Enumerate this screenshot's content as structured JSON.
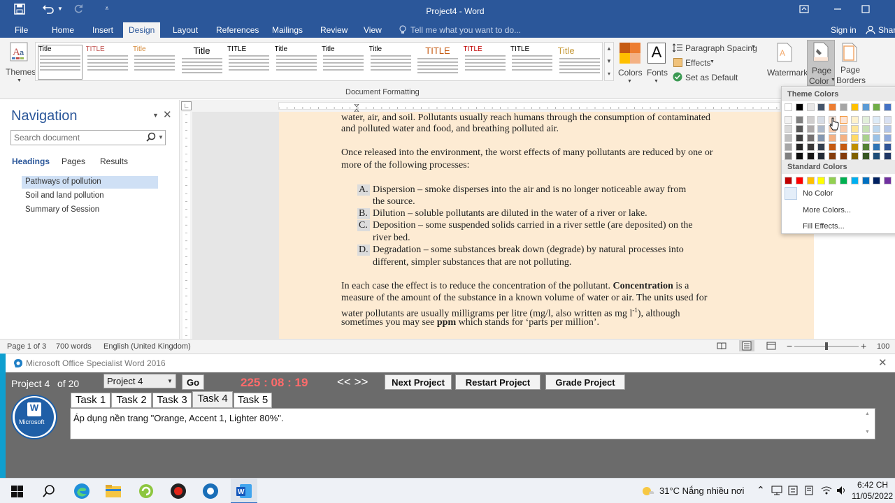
{
  "window": {
    "title": "Project4 - Word",
    "quick_access": [
      "save-icon",
      "undo-icon",
      "redo-icon",
      "customize-icon"
    ]
  },
  "tabs": {
    "file": "File",
    "home": "Home",
    "insert": "Insert",
    "design": "Design",
    "layout": "Layout",
    "references": "References",
    "mailings": "Mailings",
    "review": "Review",
    "view": "View",
    "tell_me": "Tell me what you want to do...",
    "sign_in": "Sign in",
    "share": "Shar"
  },
  "ribbon": {
    "themes": "Themes",
    "colors": "Colors",
    "fonts": "Fonts",
    "paragraph_spacing": "Paragraph Spacing",
    "effects": "Effects",
    "set_default": "Set as Default",
    "watermark": "Watermark",
    "page_color_1": "Page",
    "page_color_2": "Color",
    "page_borders_1": "Page",
    "page_borders_2": "Borders",
    "group_label": "Document Formatting",
    "style_titles": [
      "Title",
      "TITLE",
      "Title",
      "Title",
      "TITLE",
      "Title",
      "Title",
      "Title",
      "TITLE",
      "TITLE",
      "TITLE",
      "Title"
    ],
    "style_title_colors": [
      "#000000",
      "#c0504d",
      "#d58a3a",
      "#000000",
      "#000000",
      "#000000",
      "#000000",
      "#000000",
      "#c55a11",
      "#c00000",
      "#000000",
      "#c69a3a"
    ]
  },
  "nav": {
    "title": "Navigation",
    "search_placeholder": "Search document",
    "tab_headings": "Headings",
    "tab_pages": "Pages",
    "tab_results": "Results",
    "headings": [
      "Pathways of pollution",
      "Soil and land pollution",
      "Summary of Session"
    ]
  },
  "doc": {
    "p1_l1": "water, air, and soil. Pollutants usually reach humans through the consumption of contaminated",
    "p1_l2": "and polluted water and food, and breathing polluted air.",
    "p2_l1": "Once released into the environment, the worst effects of many pollutants are reduced by one or",
    "p2_l2": "more of the following processes:",
    "list": [
      {
        "letter": "A.",
        "l1": "Dispersion – smoke disperses into the air and is no longer noticeable away from",
        "l2": "the source."
      },
      {
        "letter": "B.",
        "l1": "Dilution – soluble pollutants are diluted in the water of a river or lake.",
        "l2": ""
      },
      {
        "letter": "C.",
        "l1": "Deposition – some suspended solids carried in a river settle (are deposited) on the",
        "l2": "river bed."
      },
      {
        "letter": "D.",
        "l1": "Degradation – some substances break down (degrade) by natural processes into",
        "l2": "different, simpler substances that are not polluting."
      }
    ],
    "p3_l1a": "In each case the effect is to reduce the concentration of the pollutant. ",
    "p3_l1b": "Concentration",
    "p3_l1c": " is a",
    "p3_l2": "measure of the amount of the substance in a known volume of water or air. The units used for",
    "p3_l3a": "water pollutants are usually milligrams per litre (mg/l, also written as mg l",
    "p3_l3sup": "-1",
    "p3_l3b": "), although",
    "p3_l4a": "sometimes you may see ",
    "p3_l4b": "ppm",
    "p3_l4c": " which stands for ‘parts per million’."
  },
  "status": {
    "page": "Page 1 of 3",
    "words": "700 words",
    "language": "English (United Kingdom)",
    "zoom": "100"
  },
  "color_panel": {
    "theme_title": "Theme Colors",
    "standard_title": "Standard Colors",
    "no_color": "No Color",
    "more_colors": "More Colors...",
    "fill_effects": "Fill Effects...",
    "theme_top": [
      "#ffffff",
      "#000000",
      "#e7e6e6",
      "#44546a",
      "#ed7d31",
      "#a5a5a5",
      "#ffc000",
      "#5b9bd5",
      "#70ad47",
      "#4472c4",
      "#ed7d31"
    ],
    "theme_columns": [
      [
        "#f2f2f2",
        "#d9d9d9",
        "#bfbfbf",
        "#a6a6a6",
        "#808080"
      ],
      [
        "#808080",
        "#595959",
        "#404040",
        "#262626",
        "#0d0d0d"
      ],
      [
        "#d0cece",
        "#aeaaaa",
        "#757171",
        "#3a3838",
        "#171616"
      ],
      [
        "#d6dce5",
        "#adb9ca",
        "#8497b0",
        "#333f50",
        "#222a35"
      ],
      [
        "#fbe5d6",
        "#f8cbad",
        "#f4b183",
        "#c55a11",
        "#843c0c"
      ],
      [
        "#fce4d6",
        "#f8cbad",
        "#f4b183",
        "#c55a11",
        "#843c0c"
      ],
      [
        "#fff2cc",
        "#ffe699",
        "#ffd966",
        "#bf9000",
        "#7f6000"
      ],
      [
        "#e2efda",
        "#c6e0b4",
        "#a9d08e",
        "#548235",
        "#375623"
      ],
      [
        "#ddebf7",
        "#bdd7ee",
        "#9bc2e6",
        "#2f75b5",
        "#1f4e78"
      ],
      [
        "#d9e1f2",
        "#b4c6e7",
        "#8ea9db",
        "#305496",
        "#203764"
      ],
      [
        "#fbe5d6",
        "#f8cbad",
        "#f4b183",
        "#c55a11",
        "#843c0c"
      ]
    ],
    "standard": [
      "#c00000",
      "#ff0000",
      "#ffc000",
      "#ffff00",
      "#92d050",
      "#00b050",
      "#00b0f0",
      "#0070c0",
      "#002060",
      "#7030a0"
    ]
  },
  "exam": {
    "app_title": "Microsoft Office Specialist Word 2016",
    "project_label": "Project 4",
    "of_label": "of 20",
    "project_select": "Project 4",
    "go": "Go",
    "timer": "225 : 08 : 19",
    "nav_arrows": "<< >>",
    "next_project": "Next Project",
    "restart_project": "Restart Project",
    "grade_project": "Grade Project",
    "tasks": [
      "Task 1",
      "Task 2",
      "Task 3",
      "Task 4",
      "Task 5"
    ],
    "active_task_index": 3,
    "task_text": "Áp dụng nền trang \"Orange, Accent 1, Lighter 80%\".",
    "logo_text": "Microsoft",
    "timer_color": "#ff6b6b"
  },
  "taskbar": {
    "weather": "31°C  Nắng nhiều nơi",
    "time": "6:42 CH",
    "date": "11/05/2022"
  }
}
